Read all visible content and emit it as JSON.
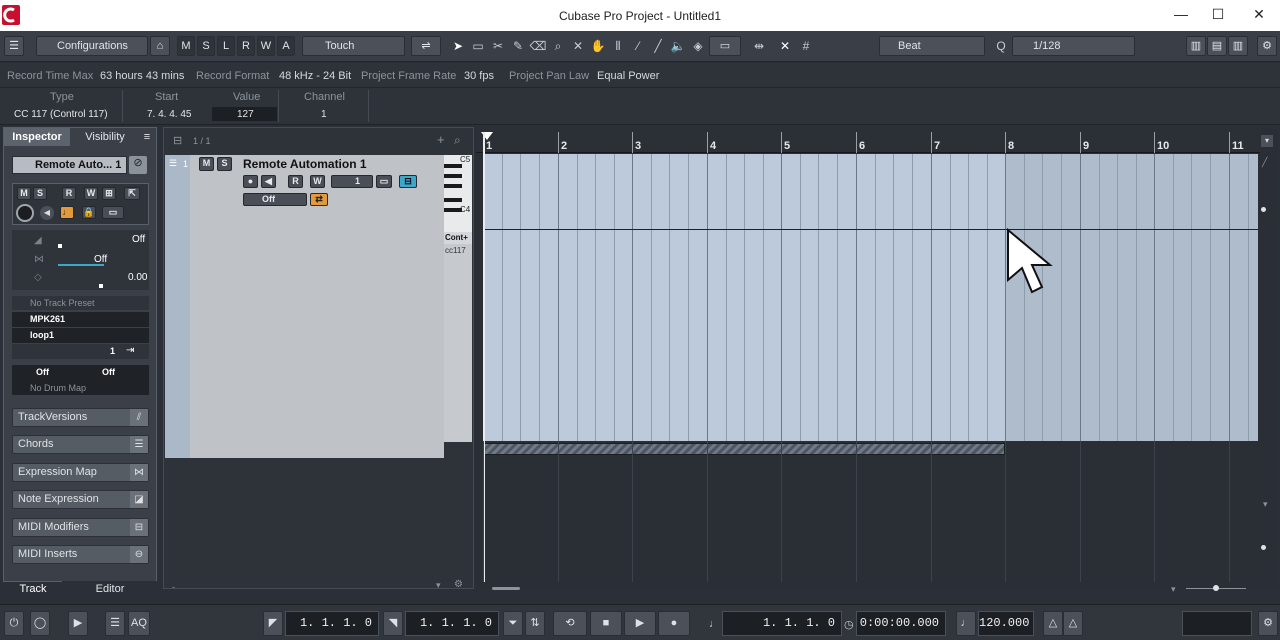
{
  "window": {
    "title": "Cubase Pro Project - Untitled1",
    "min_glyph": "—",
    "max_glyph": "☐",
    "close_glyph": "✕"
  },
  "toolbar": {
    "configurations": "Configurations",
    "m": "M",
    "s": "S",
    "l": "L",
    "r": "R",
    "w": "W",
    "a": "A",
    "automation_mode": "Touch",
    "snap_type": "Beat",
    "quantize": "1/128"
  },
  "statusline": {
    "rec_time_label": "Record Time Max",
    "rec_time_value": "63 hours 43 mins",
    "rec_format_label": "Record Format",
    "rec_format_value": "48 kHz - 24 Bit",
    "frame_rate_label": "Project Frame Rate",
    "frame_rate_value": "30 fps",
    "pan_law_label": "Project Pan Law",
    "pan_law_value": "Equal Power"
  },
  "infoline": {
    "type_label": "Type",
    "type_value": "CC 117  (Control 117)",
    "start_label": "Start",
    "start_value": "7.  4.  4.  45",
    "value_label": "Value",
    "value_value": "127",
    "channel_label": "Channel",
    "channel_value": "1"
  },
  "inspector": {
    "tab_inspector": "Inspector",
    "tab_visibility": "Visibility",
    "track_name": "Remote Auto... 1",
    "m": "M",
    "s": "S",
    "r": "R",
    "w": "W",
    "fader1_value": "Off",
    "fader2_value": "Off",
    "pan_value": "0.00",
    "track_preset": "No Track Preset",
    "input": "MPK261",
    "output": "loop1",
    "channel": "1",
    "bank_off": "Off",
    "prog_off": "Off",
    "drum_map": "No Drum Map",
    "sections": [
      "TrackVersions",
      "Chords",
      "Expression Map",
      "Note Expression",
      "MIDI Modifiers",
      "MIDI Inserts"
    ],
    "bottom_tab_track": "Track",
    "bottom_tab_editor": "Editor"
  },
  "tracklist": {
    "counter": "1 / 1",
    "track_number": "1",
    "m": "M",
    "s": "S",
    "track_name": "Remote Automation 1",
    "r": "R",
    "w": "W",
    "channel": "1",
    "off_label": "Off",
    "lane_c5": "C5",
    "lane_c4": "C4",
    "lane_name": "Cont+",
    "lane_cc": "cc117"
  },
  "ruler": {
    "bars": [
      "1",
      "2",
      "3",
      "4",
      "5",
      "6",
      "7",
      "8",
      "9",
      "10",
      "11"
    ]
  },
  "transport": {
    "left_locator": "1.  1.  1.    0",
    "right_locator": "1.  1.  1.    0",
    "position_bars": "1.  1.  1.    0",
    "position_time": "0:00:00.000",
    "tempo": "120.000",
    "aq": "AQ"
  },
  "colors": {
    "part_fill": "#bccadb",
    "logo_red": "#c8102e",
    "accent_orange": "#e39a3b",
    "accent_teal": "#3ea6c9"
  }
}
